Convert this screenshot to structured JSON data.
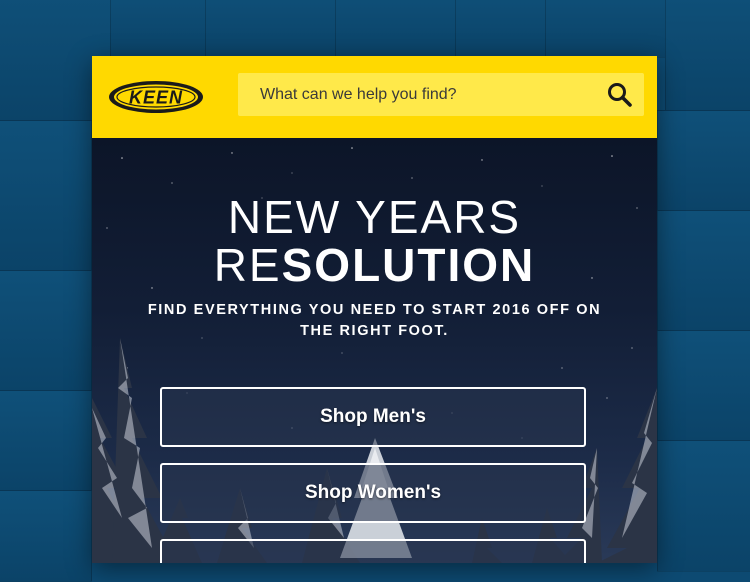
{
  "brand": {
    "logo_text": "KEEN",
    "color": "#ffd900"
  },
  "search": {
    "placeholder": "What can we help you find?",
    "icon": "search-icon"
  },
  "hero": {
    "title_line1": "NEW YEARS",
    "title_line2_light": "RE",
    "title_line2_bold": "SOLUTION",
    "subtitle": "FIND EVERYTHING YOU NEED TO START 2016 OFF ON THE RIGHT FOOT."
  },
  "ctas": [
    {
      "label": "Shop Men's"
    },
    {
      "label": "Shop Women's"
    },
    {
      "label": ""
    }
  ]
}
